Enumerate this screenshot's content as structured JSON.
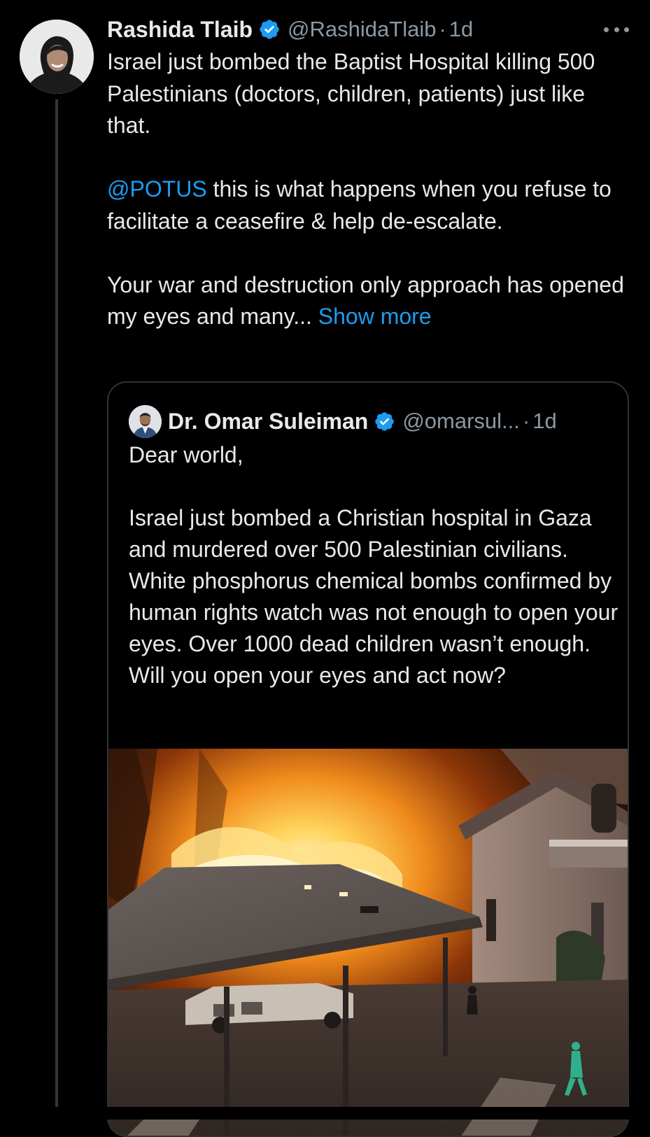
{
  "tweet": {
    "author_name": "Rashida Tlaib",
    "handle": "@RashidaTlaib",
    "separator": "·",
    "time": "1d",
    "paragraph_1": "Israel just bombed the Baptist Hospital killing 500 Palestinians (doctors, children, patients) just like that.",
    "mention": "@POTUS",
    "paragraph_2_rest": " this is what happens when you refuse to facilitate a ceasefire &  help de-escalate.",
    "paragraph_3": "Your war and destruction only approach has opened my eyes and many... ",
    "show_more": "Show more"
  },
  "quote": {
    "author_name": "Dr. Omar Suleiman",
    "handle": "@omarsul...",
    "separator": "·",
    "time": "1d",
    "paragraph_1": "Dear world,",
    "paragraph_2": "Israel just bombed a Christian hospital in Gaza and murdered over 500 Palestinian civilians. White phosphorus chemical bombs confirmed by human rights watch was not enough to open your eyes. Over 1000 dead children wasn’t enough. Will you open your eyes and act now?"
  },
  "colors": {
    "background": "#000000",
    "text": "#e7e9ea",
    "secondary": "#8b98a5",
    "link": "#1d9bf0",
    "border": "#2f3336",
    "verified": "#1d9bf0"
  },
  "icons": {
    "verified": "verified-badge-icon",
    "more": "more-options-icon"
  }
}
